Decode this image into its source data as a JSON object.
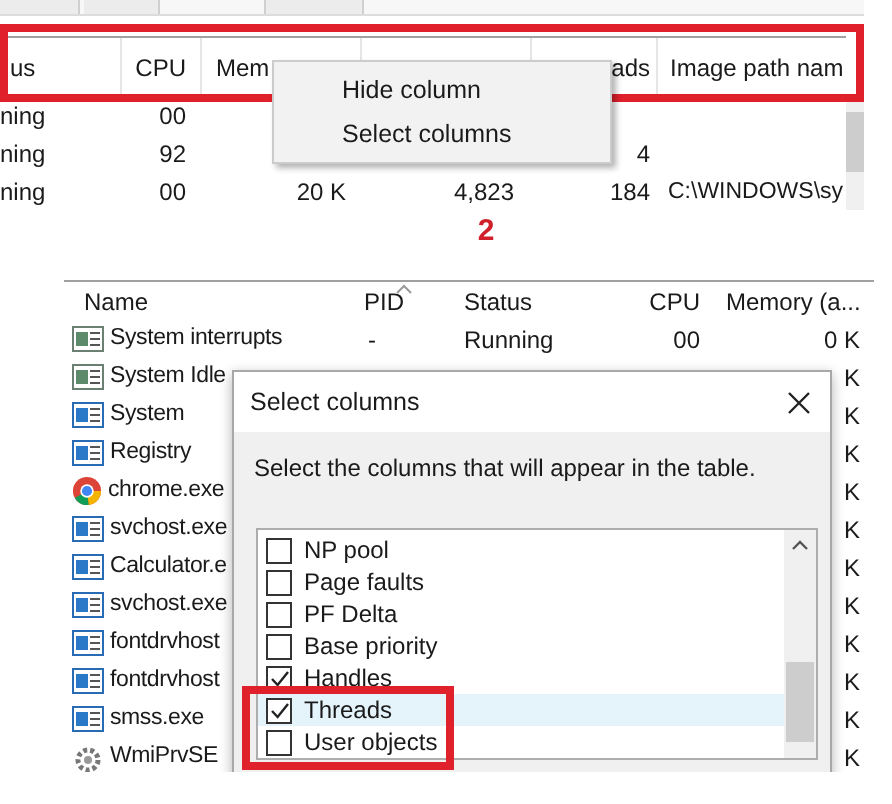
{
  "top_table": {
    "columns": {
      "status": "us",
      "cpu": "CPU",
      "memory": "Mem",
      "threads": "ads",
      "image_path": "Image path nam"
    },
    "rows": [
      {
        "status": "ning",
        "cpu": "00"
      },
      {
        "status": "ning",
        "cpu": "92",
        "threads": "4"
      },
      {
        "status": "ning",
        "cpu": "00",
        "memory": "20 K",
        "handles": "4,823",
        "threads": "184",
        "image_path": "C:\\WINDOWS\\sy"
      }
    ]
  },
  "context_menu": {
    "items": [
      {
        "label": "Hide column"
      },
      {
        "label": "Select columns"
      }
    ]
  },
  "step_label": "2",
  "process_table": {
    "columns": [
      "Name",
      "PID",
      "Status",
      "CPU",
      "Memory (a..."
    ],
    "rows": [
      {
        "kind": "system",
        "name": "System interrupts",
        "pid": "-",
        "status": "Running",
        "cpu": "00",
        "memory": "0 K"
      },
      {
        "kind": "system",
        "name": "System Idle",
        "memory": "K"
      },
      {
        "kind": "app",
        "name": "System",
        "memory": "K"
      },
      {
        "kind": "app",
        "name": "Registry",
        "memory": "K"
      },
      {
        "kind": "browser",
        "name": "chrome.exe",
        "memory": "K"
      },
      {
        "kind": "app",
        "name": "svchost.exe",
        "memory": "K"
      },
      {
        "kind": "app",
        "name": "Calculator.e",
        "memory": "K"
      },
      {
        "kind": "app",
        "name": "svchost.exe",
        "memory": "K"
      },
      {
        "kind": "app",
        "name": "fontdrvhost",
        "memory": "K"
      },
      {
        "kind": "app",
        "name": "fontdrvhost",
        "memory": "K"
      },
      {
        "kind": "app",
        "name": "smss.exe",
        "memory": "K"
      },
      {
        "kind": "gear",
        "name": "WmiPrvSE",
        "memory": "K"
      }
    ]
  },
  "dialog": {
    "title": "Select columns",
    "description": "Select the columns that will appear in the table.",
    "options": [
      {
        "label": "NP pool",
        "checked": false,
        "selected": false
      },
      {
        "label": "Page faults",
        "checked": false,
        "selected": false
      },
      {
        "label": "PF Delta",
        "checked": false,
        "selected": false
      },
      {
        "label": "Base priority",
        "checked": false,
        "selected": false
      },
      {
        "label": "Handles",
        "checked": true,
        "selected": false
      },
      {
        "label": "Threads",
        "checked": true,
        "selected": true
      },
      {
        "label": "User objects",
        "checked": false,
        "selected": false
      }
    ]
  }
}
